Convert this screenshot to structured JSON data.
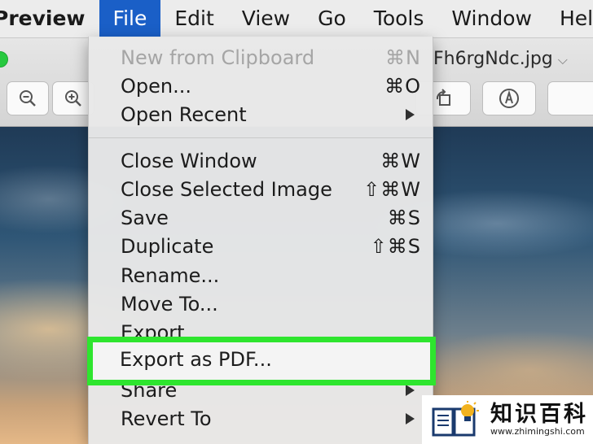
{
  "menubar": {
    "app": "Preview",
    "items": [
      "File",
      "Edit",
      "View",
      "Go",
      "Tools",
      "Window",
      "Help"
    ]
  },
  "window": {
    "title": "Fh6rgNdc.jpg"
  },
  "file_menu": {
    "items": [
      {
        "label": "New from Clipboard",
        "shortcut": "⌘N",
        "disabled": true
      },
      {
        "label": "Open...",
        "shortcut": "⌘O"
      },
      {
        "label": "Open Recent",
        "submenu": true
      },
      {
        "label": "Close Window",
        "shortcut": "⌘W"
      },
      {
        "label": "Close Selected Image",
        "shortcut": "⇧⌘W"
      },
      {
        "label": "Save",
        "shortcut": "⌘S"
      },
      {
        "label": "Duplicate",
        "shortcut": "⇧⌘S"
      },
      {
        "label": "Rename..."
      },
      {
        "label": "Move To..."
      },
      {
        "label": "Export..."
      },
      {
        "label": "Export as PDF...",
        "highlighted": true
      },
      {
        "label": "Share",
        "submenu": true
      },
      {
        "label": "Revert To",
        "submenu": true
      }
    ]
  },
  "watermark": {
    "name": "知识百科",
    "url": "www.zhimingshi.com"
  },
  "colors": {
    "menu_selected": "#1a5fc7",
    "highlight_box": "#2ee52e"
  },
  "icons": [
    "zoom-out-icon",
    "zoom-in-icon",
    "rotate-icon",
    "markup-icon",
    "chevron-down-icon",
    "submenu-arrow-icon"
  ]
}
